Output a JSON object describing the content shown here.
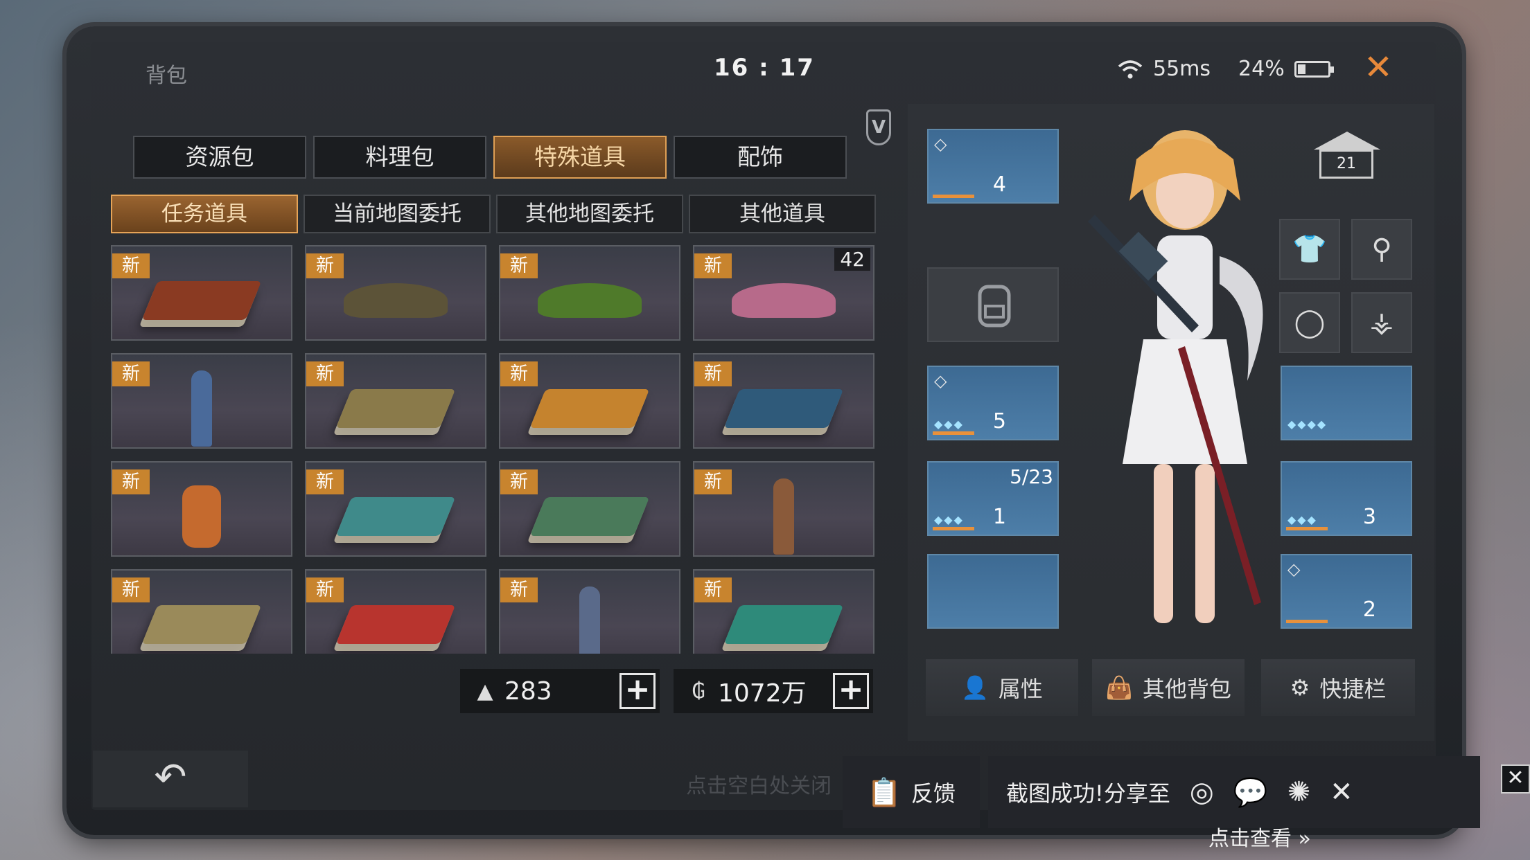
{
  "window": {
    "title": "背包",
    "time": "16 : 17",
    "ping": "55ms",
    "battery": "24%",
    "battery_level": 0.24,
    "close_symbol": "✕"
  },
  "category_tabs": [
    {
      "label": "资源包",
      "active": false
    },
    {
      "label": "料理包",
      "active": false
    },
    {
      "label": "特殊道具",
      "active": true
    },
    {
      "label": "配饰",
      "active": false
    }
  ],
  "sub_tabs": [
    {
      "label": "任务道具",
      "active": true
    },
    {
      "label": "当前地图委托",
      "active": false
    },
    {
      "label": "其他地图委托",
      "active": false
    },
    {
      "label": "其他道具",
      "active": false
    }
  ],
  "v_badge": "V",
  "items": [
    {
      "tag": "新",
      "kind": "book",
      "color": "#8a3a22",
      "qty": ""
    },
    {
      "tag": "新",
      "kind": "pile",
      "color": "#5c5338",
      "qty": ""
    },
    {
      "tag": "新",
      "kind": "pile",
      "color": "#4f7a2a",
      "qty": ""
    },
    {
      "tag": "新",
      "kind": "pile",
      "color": "#b76a8a",
      "qty": "42"
    },
    {
      "tag": "新",
      "kind": "figure",
      "color": "#4a6a9a",
      "qty": ""
    },
    {
      "tag": "新",
      "kind": "book",
      "color": "#8a7a4a",
      "qty": ""
    },
    {
      "tag": "新",
      "kind": "book",
      "color": "#c5832e",
      "qty": ""
    },
    {
      "tag": "新",
      "kind": "book",
      "color": "#2f5a7a",
      "qty": ""
    },
    {
      "tag": "新",
      "kind": "bottle",
      "color": "#c56a2e",
      "qty": ""
    },
    {
      "tag": "新",
      "kind": "book",
      "color": "#3f8a8a",
      "qty": ""
    },
    {
      "tag": "新",
      "kind": "book",
      "color": "#4a7a5a",
      "qty": ""
    },
    {
      "tag": "新",
      "kind": "figure",
      "color": "#8a5a3a",
      "qty": ""
    },
    {
      "tag": "新",
      "kind": "book",
      "color": "#9a8a5a",
      "qty": ""
    },
    {
      "tag": "新",
      "kind": "book",
      "color": "#b8342e",
      "qty": ""
    },
    {
      "tag": "新",
      "kind": "figure",
      "color": "#5a6a8a",
      "qty": ""
    },
    {
      "tag": "新",
      "kind": "book",
      "color": "#2e8a7a",
      "qty": ""
    }
  ],
  "currency": {
    "capacity": {
      "icon": "capacity-icon",
      "value": "283"
    },
    "gold": {
      "icon": "coin-icon",
      "value": "1072万"
    }
  },
  "equipment": {
    "slot_top": {
      "stars": "4"
    },
    "slot_armor": {
      "stars": "5"
    },
    "slot_weapon": {
      "stars": "1",
      "count": "5/23"
    },
    "slot_bracelet": {},
    "slot_blade": {
      "stars": "3"
    },
    "slot_pet": {
      "stars": "2"
    },
    "house_level": "21"
  },
  "bottom_buttons": {
    "attributes": "属性",
    "other_bag": "其他背包",
    "shortcut": "快捷栏"
  },
  "hint": "点击空白处关闭",
  "share": {
    "feedback": "反馈",
    "message": "截图成功!分享至",
    "view": "点击查看"
  },
  "colors": {
    "accent": "#e8893a",
    "tab_active": "#c8842e",
    "equip_blue": "#4d7ea8"
  }
}
